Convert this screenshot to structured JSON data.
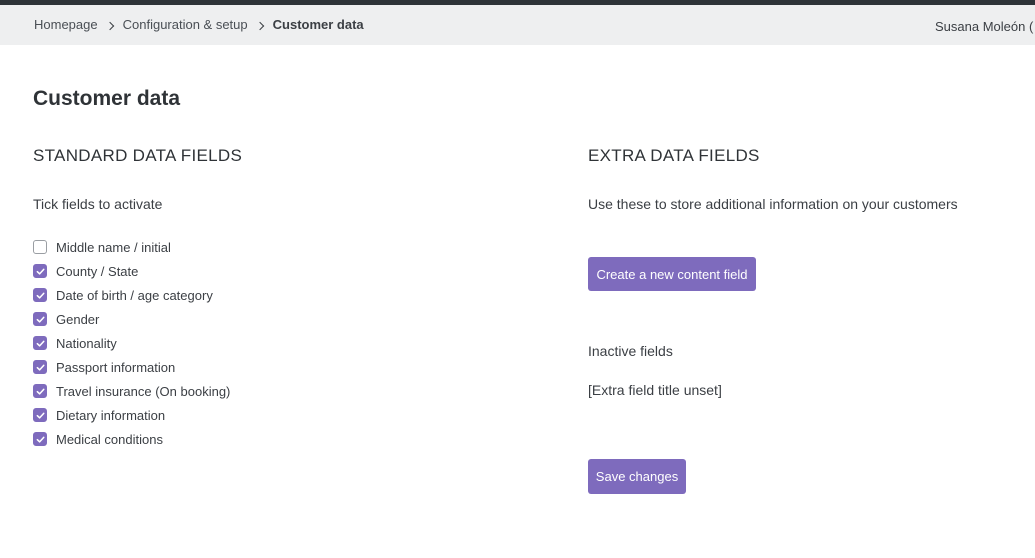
{
  "breadcrumb": {
    "items": [
      "Homepage",
      "Configuration & setup"
    ],
    "current": "Customer data"
  },
  "user": {
    "name": "Susana Moleón ("
  },
  "page": {
    "title": "Customer data"
  },
  "standard": {
    "title": "STANDARD DATA FIELDS",
    "hint": "Tick fields to activate",
    "fields": [
      {
        "label": "Middle name / initial",
        "checked": false
      },
      {
        "label": "County / State",
        "checked": true
      },
      {
        "label": "Date of birth / age category",
        "checked": true
      },
      {
        "label": "Gender",
        "checked": true
      },
      {
        "label": "Nationality",
        "checked": true
      },
      {
        "label": "Passport information",
        "checked": true
      },
      {
        "label": "Travel insurance (On booking)",
        "checked": true
      },
      {
        "label": "Dietary information",
        "checked": true
      },
      {
        "label": "Medical conditions",
        "checked": true
      }
    ]
  },
  "extra": {
    "title": "EXTRA DATA FIELDS",
    "hint": "Use these to store additional information on your customers",
    "create_button": "Create a new content field",
    "inactive_label": "Inactive fields",
    "inactive_items": [
      "[Extra field title unset]"
    ],
    "save_button": "Save changes"
  },
  "colors": {
    "accent": "#7e6bbd",
    "header_bg": "#eeeff0",
    "top_strip": "#2e3338"
  }
}
